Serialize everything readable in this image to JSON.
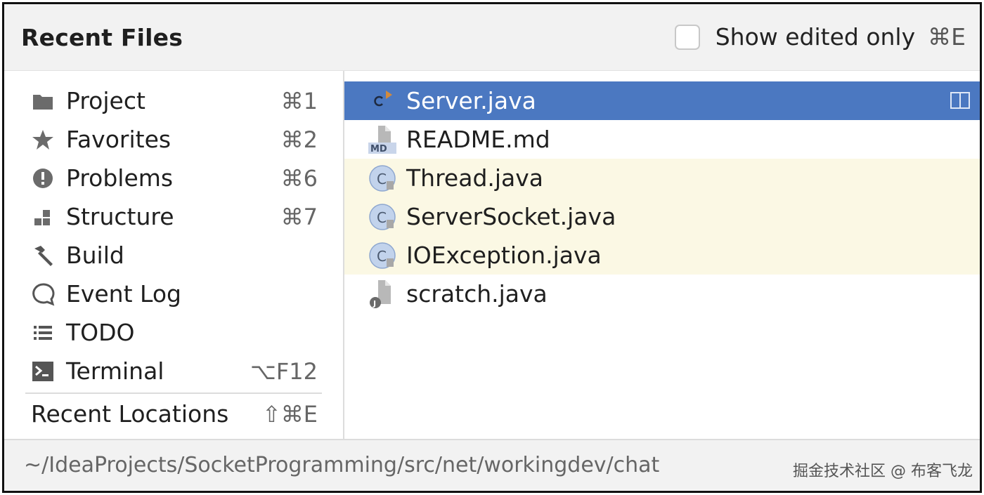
{
  "header": {
    "title": "Recent Files",
    "show_edited_label": "Show edited only",
    "show_edited_shortcut": "⌘E",
    "show_edited_checked": false
  },
  "nav": {
    "items": [
      {
        "label": "Project",
        "shortcut": "⌘1",
        "icon": "folder-icon"
      },
      {
        "label": "Favorites",
        "shortcut": "⌘2",
        "icon": "star-icon"
      },
      {
        "label": "Problems",
        "shortcut": "⌘6",
        "icon": "error-icon"
      },
      {
        "label": "Structure",
        "shortcut": "⌘7",
        "icon": "structure-icon"
      },
      {
        "label": "Build",
        "shortcut": "",
        "icon": "hammer-icon"
      },
      {
        "label": "Event Log",
        "shortcut": "",
        "icon": "speech-bubble-icon"
      },
      {
        "label": "TODO",
        "shortcut": "",
        "icon": "list-icon"
      },
      {
        "label": "Terminal",
        "shortcut": "⌥F12",
        "icon": "terminal-icon"
      }
    ],
    "recent_locations": {
      "label": "Recent Locations",
      "shortcut": "⇧⌘E"
    }
  },
  "files": [
    {
      "name": "Server.java",
      "icon": "java-run-icon",
      "state": "selected"
    },
    {
      "name": "README.md",
      "icon": "markdown-file-icon",
      "state": "normal"
    },
    {
      "name": "Thread.java",
      "icon": "java-class-readonly-icon",
      "state": "noneditable"
    },
    {
      "name": "ServerSocket.java",
      "icon": "java-class-readonly-icon",
      "state": "noneditable"
    },
    {
      "name": "IOException.java",
      "icon": "java-class-readonly-icon",
      "state": "noneditable"
    },
    {
      "name": "scratch.java",
      "icon": "java-scratch-icon",
      "state": "normal"
    }
  ],
  "footer": {
    "path": "~/IdeaProjects/SocketProgramming/src/net/workingdev/chat",
    "watermark": "掘金技术社区 @ 布客飞龙"
  },
  "colors": {
    "selection": "#4b78c1",
    "noneditable_bg": "#fbf8e4",
    "header_bg": "#f2f2f2"
  }
}
